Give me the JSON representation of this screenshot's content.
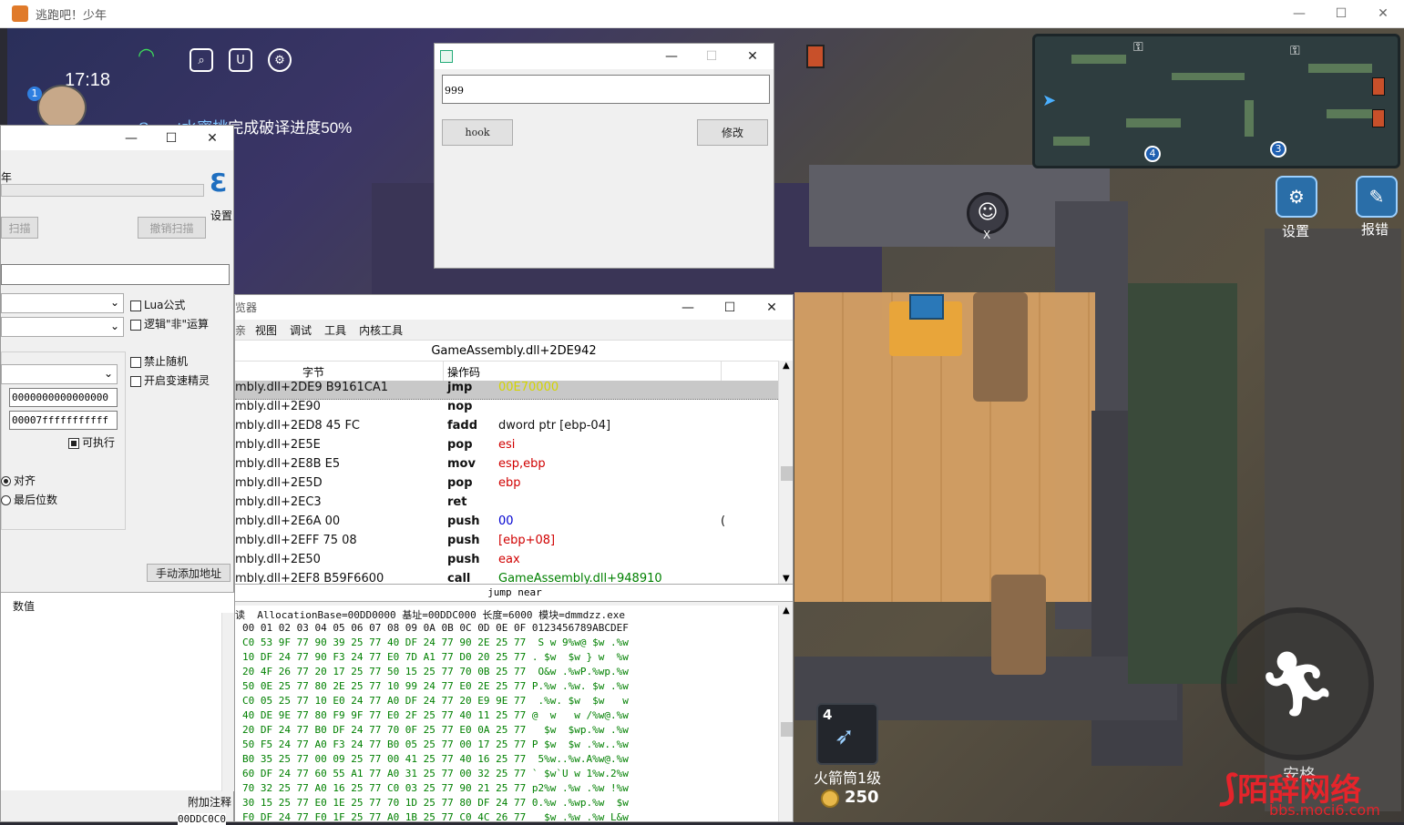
{
  "emulator": {
    "title": "逃跑吧！少年",
    "controls": {
      "minimize": "—",
      "maximize": "☐",
      "close": "✕"
    }
  },
  "game": {
    "time": "17:18",
    "player_level": "1",
    "progress_name": "Sweet水蜜桃",
    "progress_text": "完成破译进度50%",
    "settings_label": "设置",
    "report_label": "报错",
    "close_x": "X",
    "item_count": "4",
    "item_name": "火箭筒1级",
    "coins": "250",
    "hidden_label": "安格",
    "minimap_markers": [
      "4",
      "3"
    ]
  },
  "watermark": {
    "text": "陌辞网络",
    "url": "bbs.moci6.com"
  },
  "hook_dialog": {
    "input_value": "999",
    "hook_button": "hook",
    "modify_button": "修改",
    "controls": {
      "minimize": "—",
      "maximize": "☐",
      "close": "✕"
    }
  },
  "ce_main": {
    "title_fragment": "年",
    "settings_label": "设置",
    "scan_button": "扫描",
    "undo_scan_button": "撤销扫描",
    "lua_formula": "Lua公式",
    "logic_not": "逻辑\"非\"运算",
    "no_random": "禁止随机",
    "speedhack": "开启变速精灵",
    "start_addr": "0000000000000000",
    "end_addr": "00007fffffffffff",
    "executable": "可执行",
    "align": "对齐",
    "last_digits": "最后位数",
    "add_address_button": "手动添加地址",
    "value_header": "数值",
    "add_comment": "附加注释",
    "controls": {
      "minimize": "—",
      "maximize": "☐",
      "close": "✕"
    }
  },
  "memory_viewer": {
    "title_fragment": "览器",
    "menu": [
      "视图",
      "调试",
      "工具",
      "内核工具"
    ],
    "menu_fragment": "亲",
    "address": "GameAssembly.dll+2DE942",
    "col_bytes": "字节",
    "col_opcode": "操作码",
    "status": "jump near",
    "controls": {
      "minimize": "—",
      "maximize": "☐",
      "close": "✕"
    },
    "disasm": [
      {
        "addr": "mbly.dll+2DE9 B9161CA1",
        "op": "jmp",
        "arg": "00E70000",
        "argColor": "#d4d400",
        "cmt": "",
        "sel": true
      },
      {
        "addr": "mbly.dll+2E90",
        "op": "nop",
        "arg": "",
        "argColor": "#111",
        "cmt": ""
      },
      {
        "addr": "mbly.dll+2ED8 45 FC",
        "op": "fadd",
        "arg": "dword ptr [ebp-04]",
        "argColor": "#111",
        "cmt": ""
      },
      {
        "addr": "mbly.dll+2E5E",
        "op": "pop",
        "arg": "esi",
        "argColor": "#d00000",
        "cmt": ""
      },
      {
        "addr": "mbly.dll+2E8B E5",
        "op": "mov",
        "arg": "esp,ebp",
        "argColor": "#d00000",
        "cmt": ""
      },
      {
        "addr": "mbly.dll+2E5D",
        "op": "pop",
        "arg": "ebp",
        "argColor": "#d00000",
        "cmt": ""
      },
      {
        "addr": "mbly.dll+2EC3",
        "op": "ret",
        "arg": "",
        "argColor": "#111",
        "cmt": ""
      },
      {
        "addr": "mbly.dll+2E6A 00",
        "op": "push",
        "arg": "00",
        "argColor": "#0000d0",
        "cmt": "("
      },
      {
        "addr": "mbly.dll+2EFF 75 08",
        "op": "push",
        "arg": "[ebp+08]",
        "argColor": "#d00000",
        "cmt": ""
      },
      {
        "addr": "mbly.dll+2E50",
        "op": "push",
        "arg": "eax",
        "argColor": "#d00000",
        "cmt": ""
      },
      {
        "addr": "mbly.dll+2EF8 B59F6600",
        "op": "call",
        "arg": "GameAssembly.dll+948910",
        "argColor": "#008000",
        "cmt": ""
      }
    ],
    "hex_header": "AllocationBase=00DD0000 基址=00DDC000 长度=6000 模块=dmmdzz.exe",
    "hex_header_prefix": "读",
    "hex_columns": "00 01 02 03 04 05 06 07 08 09 0A 0B 0C 0D 0E 0F 0123456789ABCDEF",
    "hex_rows": [
      {
        "bytes": "C0 53 9F 77 90 39 25 77 40 DF 24 77 90 2E 25 77",
        "ascii": " S w 9%w@ $w .%w"
      },
      {
        "bytes": "10 DF 24 77 90 F3 24 77 E0 7D A1 77 D0 20 25 77",
        "ascii": ". $w  $w } w  %w"
      },
      {
        "bytes": "20 4F 26 77 20 17 25 77 50 15 25 77 70 0B 25 77",
        "ascii": " O&w .%wP.%wp.%w"
      },
      {
        "bytes": "50 0E 25 77 80 2E 25 77 10 99 24 77 E0 2E 25 77",
        "ascii": "P.%w .%w. $w .%w"
      },
      {
        "bytes": "C0 05 25 77 10 E0 24 77 A0 DF 24 77 20 E9 9E 77",
        "ascii": " .%w. $w  $w   w"
      },
      {
        "bytes": "40 DE 9E 77 80 F9 9F 77 E0 2F 25 77 40 11 25 77",
        "ascii": "@  w   w /%w@.%w"
      },
      {
        "bytes": "20 DF 24 77 B0 DF 24 77 70 0F 25 77 E0 0A 25 77",
        "ascii": "  $w  $wp.%w .%w"
      },
      {
        "bytes": "50 F5 24 77 A0 F3 24 77 B0 05 25 77 00 17 25 77",
        "ascii": "P $w  $w .%w..%w"
      },
      {
        "bytes": "B0 35 25 77 00 09 25 77 00 41 25 77 40 16 25 77",
        "ascii": " 5%w..%w.A%w@.%w"
      },
      {
        "bytes": "60 DF 24 77 60 55 A1 77 A0 31 25 77 00 32 25 77",
        "ascii": "` $w`U w 1%w.2%w"
      },
      {
        "bytes": "70 32 25 77 A0 16 25 77 C0 03 25 77 90 21 25 77",
        "ascii": "p2%w .%w .%w !%w"
      },
      {
        "bytes": "30 15 25 77 E0 1E 25 77 70 1D 25 77 80 DF 24 77",
        "ascii": "0.%w .%wp.%w  $w"
      },
      {
        "bytes": "F0 DF 24 77 F0 1F 25 77 A0 1B 25 77 C0 4C 26 77",
        "ascii": "  $w .%w .%w L&w"
      }
    ],
    "hex_addr_fragment": "00DDC0C0"
  }
}
